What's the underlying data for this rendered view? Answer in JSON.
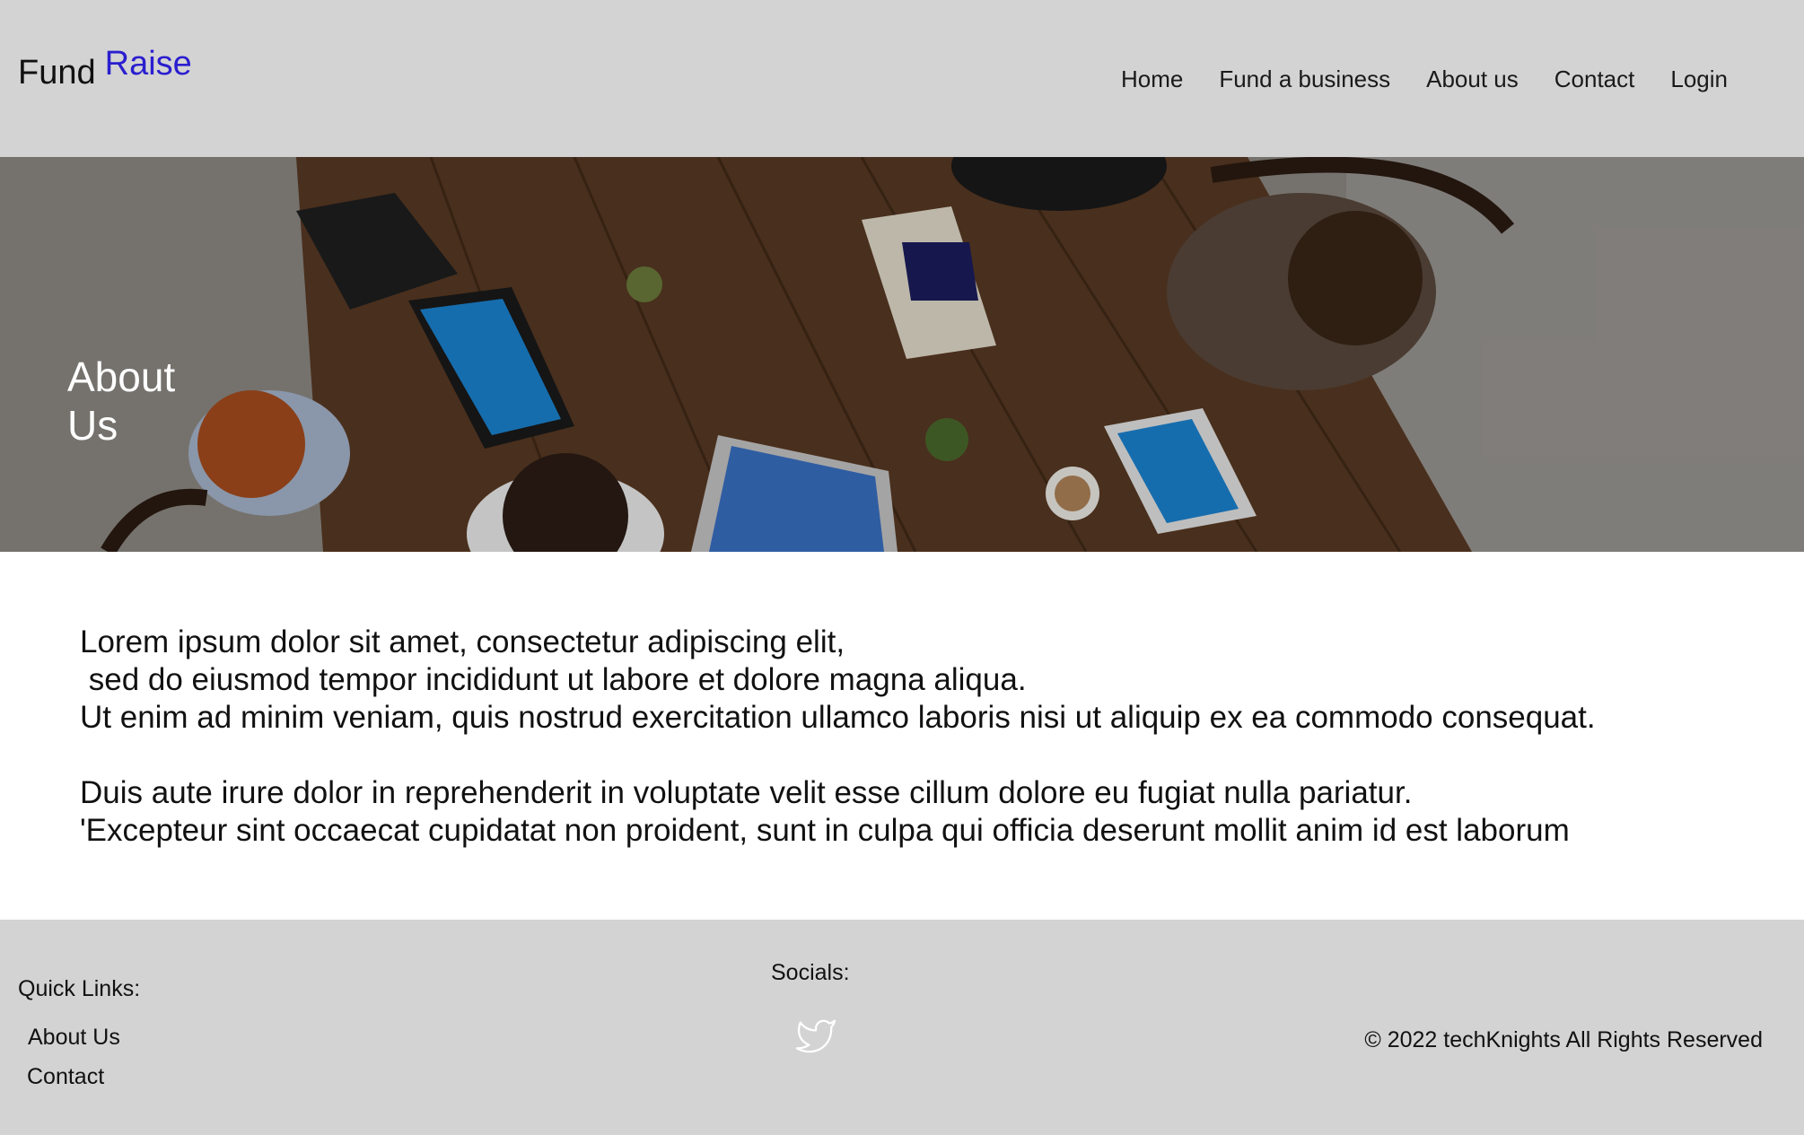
{
  "brand": {
    "first": "Fund",
    "second": "Raise",
    "second_color": "#2a1ecf"
  },
  "nav": {
    "items": [
      "Home",
      "Fund a business",
      "About us",
      "Contact",
      "Login"
    ]
  },
  "hero": {
    "title": "About Us",
    "image": "team-meeting-photo"
  },
  "content": {
    "paragraph_1": [
      "Lorem ipsum dolor sit amet, consectetur adipiscing elit,",
      " sed do eiusmod tempor incididunt ut labore et dolore magna aliqua.",
      "Ut enim ad minim veniam, quis nostrud exercitation ullamco laboris nisi ut aliquip ex ea commodo consequat."
    ],
    "paragraph_2": [
      "Duis aute irure dolor in reprehenderit in voluptate velit esse cillum dolore eu fugiat nulla pariatur.",
      "'Excepteur sint occaecat cupidatat non proident, sunt in culpa qui officia deserunt mollit anim id est laborum"
    ]
  },
  "footer": {
    "quick_links_title": "Quick Links:",
    "quick_links": [
      "About Us",
      "Contact"
    ],
    "socials_title": "Socials:",
    "socials": [
      "twitter-icon"
    ],
    "copyright": "© 2022 techKnights All Rights Reserved"
  },
  "colors": {
    "header_bg": "#d3d3d3",
    "footer_bg": "#d3d3d3",
    "hero_text": "#ffffff"
  }
}
